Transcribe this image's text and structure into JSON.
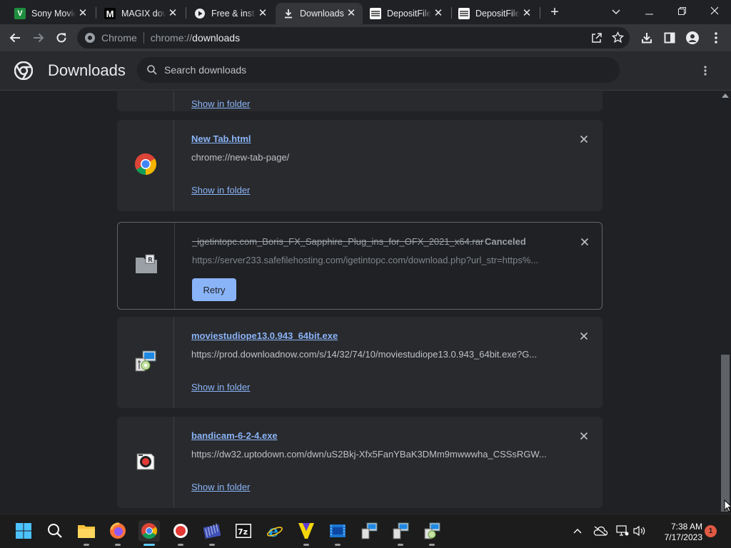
{
  "browser": {
    "tabs": [
      {
        "title": "Sony Movie Studio",
        "favicon": "green-v-icon",
        "fav_color": "#1e8e3e",
        "fav_char": "V"
      },
      {
        "title": "MAGIX download",
        "favicon": "magix-m-icon",
        "fav_color": "#000000",
        "fav_char": "M"
      },
      {
        "title": "Free & instant",
        "favicon": "play-circle-icon",
        "fav_color": "#3c4043",
        "fav_char": "▶"
      },
      {
        "title": "Downloads",
        "favicon": "download-icon",
        "fav_color": "#35363a",
        "fav_char": "⬇"
      },
      {
        "title": "DepositFiles",
        "favicon": "depositfiles-icon",
        "fav_color": "#ffffff",
        "fav_char": "≡"
      },
      {
        "title": "DepositFiles",
        "favicon": "depositfiles-icon",
        "fav_color": "#ffffff",
        "fav_char": "≡"
      }
    ],
    "active_tab_index": 3,
    "omnibox": {
      "site_label": "Chrome",
      "url_scheme": "chrome://",
      "url_host": "downloads"
    }
  },
  "downloads_page": {
    "title": "Downloads",
    "search_placeholder": "Search downloads",
    "top_partial_link": "Show in folder",
    "items": [
      {
        "filename": "New Tab.html",
        "url": "chrome://new-tab-page/",
        "action": "Show in folder",
        "icon": "chrome-logo-icon",
        "state": "complete"
      },
      {
        "filename": "_igetintopc.com_Boris_FX_Sapphire_Plug_ins_for_OFX_2021_x64.rar",
        "status": "Canceled",
        "url": "https://server233.safefilehosting.com/igetintopc.com/download.php?url_str=https%...",
        "action": "Retry",
        "icon": "winrar-archive-icon",
        "state": "canceled"
      },
      {
        "filename": "moviestudiope13.0.943_64bit.exe",
        "url": "https://prod.downloadnow.com/s/14/32/74/10/moviestudiope13.0.943_64bit.exe?G...",
        "action": "Show in folder",
        "icon": "installer-exe-icon",
        "state": "complete"
      },
      {
        "filename": "bandicam-6-2-4.exe",
        "url": "https://dw32.uptodown.com/dwn/uS2Bkj-Xfx5FanYBaK3DMm9mwwwha_CSSsRGW...",
        "action": "Show in folder",
        "icon": "bandicam-icon",
        "state": "complete"
      }
    ]
  },
  "taskbar": {
    "apps": [
      "start-icon",
      "search-icon",
      "file-explorer-icon",
      "firefox-icon",
      "chrome-icon",
      "bandicam-record-icon",
      "movie-studio-icon",
      "7zip-icon",
      "internet-explorer-icon",
      "magix-vegas-icon",
      "video-editor-icon",
      "installer-icon",
      "installer-icon",
      "installer-icon"
    ],
    "clock_time": "7:38 AM",
    "clock_date": "7/17/2023",
    "notification_count": "1"
  }
}
